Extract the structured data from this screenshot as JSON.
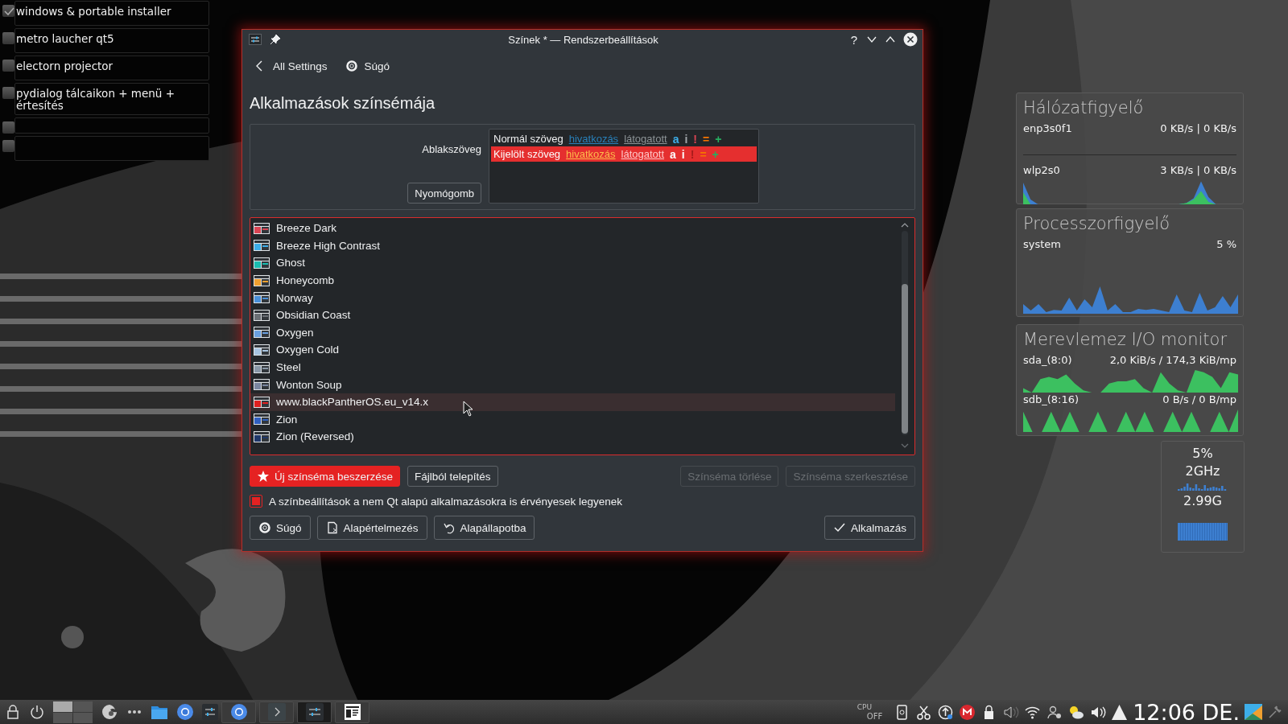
{
  "todo_list": {
    "items": [
      {
        "text": "windows & portable installer",
        "checked": true
      },
      {
        "text": "metro laucher qt5",
        "checked": false
      },
      {
        "text": "electorn projector",
        "checked": false
      },
      {
        "text": "pydialog tálcaikon + menü + értesítés",
        "checked": false
      },
      {
        "checked": false
      },
      {
        "checked": false
      }
    ]
  },
  "dialog": {
    "title": "Színek * — Rendszerbeállítások",
    "help_button": "?",
    "nav": [
      "All Settings",
      "Súgó"
    ],
    "heading": "Alkalmazások színsémája",
    "preview": {
      "label": "Ablakszöveg",
      "push_button": "Nyomógomb",
      "rows": [
        {
          "selected": false,
          "segments": [
            {
              "kind": "text",
              "text": "Normál szöveg",
              "color": "#eff0f1"
            },
            {
              "kind": "link",
              "text": "hivatkozás",
              "color": "#2980b9"
            },
            {
              "kind": "link",
              "text": "látogatott",
              "color": "#8c9396"
            },
            {
              "kind": "mark",
              "text": "a",
              "color": "#3daee9"
            },
            {
              "kind": "mark",
              "text": "i",
              "color": "#a0a4a8"
            },
            {
              "kind": "mark",
              "text": "!",
              "color": "#da4453"
            },
            {
              "kind": "mark",
              "text": "=",
              "color": "#f67400"
            },
            {
              "kind": "mark",
              "text": "+",
              "color": "#27ae60"
            }
          ]
        },
        {
          "selected": true,
          "segments": [
            {
              "kind": "text",
              "text": "Kijelölt szöveg",
              "color": "#fcfcfc"
            },
            {
              "kind": "link",
              "text": "hivatkozás",
              "color": "#fdbc4b"
            },
            {
              "kind": "link",
              "text": "látogatott",
              "color": "#ffc8c8"
            },
            {
              "kind": "mark",
              "text": "a",
              "color": "#fcfcfc"
            },
            {
              "kind": "mark",
              "text": "i",
              "color": "#fcfcfc"
            },
            {
              "kind": "mark",
              "text": "!",
              "color": "#a81c1c"
            },
            {
              "kind": "mark",
              "text": "=",
              "color": "#f67400"
            },
            {
              "kind": "mark",
              "text": "+",
              "color": "#27ae60"
            }
          ]
        }
      ]
    },
    "schemes": [
      {
        "name": "Breeze Dark",
        "color": "#da4453",
        "highlighted": false
      },
      {
        "name": "Breeze High Contrast",
        "color": "#3daee9",
        "highlighted": false
      },
      {
        "name": "Ghost",
        "color": "#1abcb0",
        "highlighted": false
      },
      {
        "name": "Honeycomb",
        "color": "#f0a030",
        "highlighted": false
      },
      {
        "name": "Norway",
        "color": "#4a90d9",
        "highlighted": false
      },
      {
        "name": "Obsidian Coast",
        "color": "#6a6f75",
        "highlighted": false
      },
      {
        "name": "Oxygen",
        "color": "#6aa0e0",
        "highlighted": false
      },
      {
        "name": "Oxygen Cold",
        "color": "#a8c4e0",
        "highlighted": false
      },
      {
        "name": "Steel",
        "color": "#8a98a8",
        "highlighted": false
      },
      {
        "name": "Wonton Soup",
        "color": "#7a86a0",
        "highlighted": false
      },
      {
        "name": "www.blackPantherOS.eu_v14.x",
        "color": "#e02020",
        "highlighted": true
      },
      {
        "name": "Zion",
        "color": "#3060c0",
        "highlighted": false
      },
      {
        "name": "Zion (Reversed)",
        "color": "#20386a",
        "highlighted": false
      }
    ],
    "actions": [
      {
        "label": "Új színséma beszerzése",
        "kind": "accent",
        "disabled": false
      },
      {
        "label": "Fájlból telepítés",
        "kind": "normal",
        "disabled": false
      },
      {
        "label": "Színséma törlése",
        "kind": "normal",
        "disabled": true
      },
      {
        "label": "Színséma szerkesztése",
        "kind": "normal",
        "disabled": true
      }
    ],
    "apply_to_non_qt": {
      "label": "A színbeállítások a nem Qt alapú alkalmazásokra is érvényesek legyenek",
      "checked": true
    },
    "footer_left": [
      "Súgó",
      "Alapértelmezés",
      "Alapállapotba"
    ],
    "footer_right": [
      "Alkalmazás"
    ]
  },
  "network_monitor": {
    "title": "Hálózatfigyelő",
    "interfaces": [
      {
        "name": "enp3s0f1",
        "rate": "0 KB/s | 0 KB/s"
      },
      {
        "name": "wlp2s0",
        "rate": "3 KB/s | 0 KB/s"
      }
    ]
  },
  "cpu_monitor": {
    "title": "Processzorfigyelő",
    "name": "system",
    "value": "5 %"
  },
  "disk_monitor": {
    "title": "Merevlemez I/O monitor",
    "disks": [
      {
        "name": "sda_(8:0)",
        "rate": "2,0 KiB/s / 174,3 KiB/mp"
      },
      {
        "name": "sdb_(8:16)",
        "rate": "0 B/s / 0 B/mp"
      }
    ]
  },
  "system_load": {
    "cpu": "5%",
    "frequency": "2GHz",
    "memory": "2.99G"
  },
  "taskbar": {
    "desktops": [
      {
        "selected": true
      },
      {
        "selected": false
      },
      {
        "selected": false
      },
      {
        "selected": false
      }
    ],
    "tasks": [
      {
        "selected": false
      },
      {
        "selected": false
      },
      {
        "selected": true
      },
      {
        "selected": false
      }
    ],
    "cpu_label": "CPU",
    "cpu_state": "OFF",
    "clock": "12:06 DE."
  }
}
